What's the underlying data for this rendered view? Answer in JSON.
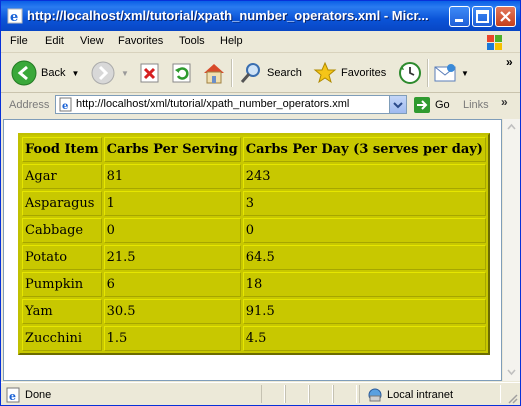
{
  "window": {
    "title": "http://localhost/xml/tutorial/xpath_number_operators.xml - Micr..."
  },
  "menu": {
    "file": "File",
    "edit": "Edit",
    "view": "View",
    "favorites": "Favorites",
    "tools": "Tools",
    "help": "Help"
  },
  "toolbar": {
    "back": "Back",
    "search": "Search",
    "favorites": "Favorites"
  },
  "address": {
    "label": "Address",
    "url": "http://localhost/xml/tutorial/xpath_number_operators.xml",
    "go": "Go",
    "links": "Links"
  },
  "table": {
    "headers": [
      "Food Item",
      "Carbs Per Serving",
      "Carbs Per Day (3 serves per day)"
    ],
    "rows": [
      [
        "Agar",
        "81",
        "243"
      ],
      [
        "Asparagus",
        "1",
        "3"
      ],
      [
        "Cabbage",
        "0",
        "0"
      ],
      [
        "Potato",
        "21.5",
        "64.5"
      ],
      [
        "Pumpkin",
        "6",
        "18"
      ],
      [
        "Yam",
        "30.5",
        "91.5"
      ],
      [
        "Zucchini",
        "1.5",
        "4.5"
      ]
    ]
  },
  "status": {
    "text": "Done",
    "zone": "Local intranet"
  }
}
